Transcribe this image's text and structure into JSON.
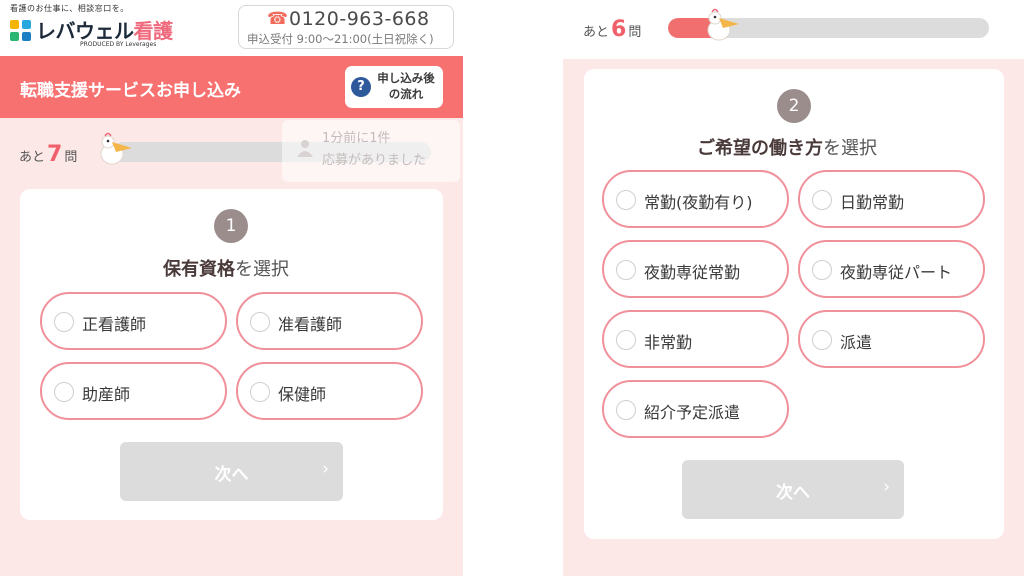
{
  "left": {
    "header": {
      "tagline": "看護のお仕事に、相談窓口を。",
      "logo_text": "レバウェル",
      "logo_accent": "看護",
      "logo_sub": "PRODUCED BY Leverages",
      "phone_number": "0120-963-668",
      "phone_hours": "申込受付 9:00〜21:00(土日祝除く)"
    },
    "title_bar": {
      "title": "転職支援サービスお申し込み",
      "flow_button": "申し込み後の流れ",
      "flow_icon": "question-icon"
    },
    "progress": {
      "prefix": "あと",
      "remaining": "7",
      "suffix": "問",
      "fraction": 0.0
    },
    "toast": {
      "line1": "1分前に1件",
      "line2": "応募がありました"
    },
    "question": {
      "step": "1",
      "title_bold": "保有資格",
      "title_rest": "を選択",
      "options": [
        "正看護師",
        "准看護師",
        "助産師",
        "保健師"
      ],
      "next_label": "次へ",
      "next_chevron": "›"
    }
  },
  "right": {
    "progress": {
      "prefix": "あと",
      "remaining": "6",
      "suffix": "問",
      "fraction": 0.14
    },
    "question": {
      "step": "2",
      "title_bold": "ご希望の働き方",
      "title_rest": "を選択",
      "options": [
        "常勤(夜勤有り)",
        "日勤常勤",
        "夜勤専従常勤",
        "夜勤専従パート",
        "非常勤",
        "派遣",
        "紹介予定派遣"
      ],
      "next_label": "次へ",
      "next_chevron": "›"
    }
  },
  "colors": {
    "brand_coral": "#f67170",
    "option_border": "#f0909a",
    "page_pink": "#fde8e8",
    "disabled_button": "#dcdcdc",
    "step_badge": "#9c8d8d"
  }
}
